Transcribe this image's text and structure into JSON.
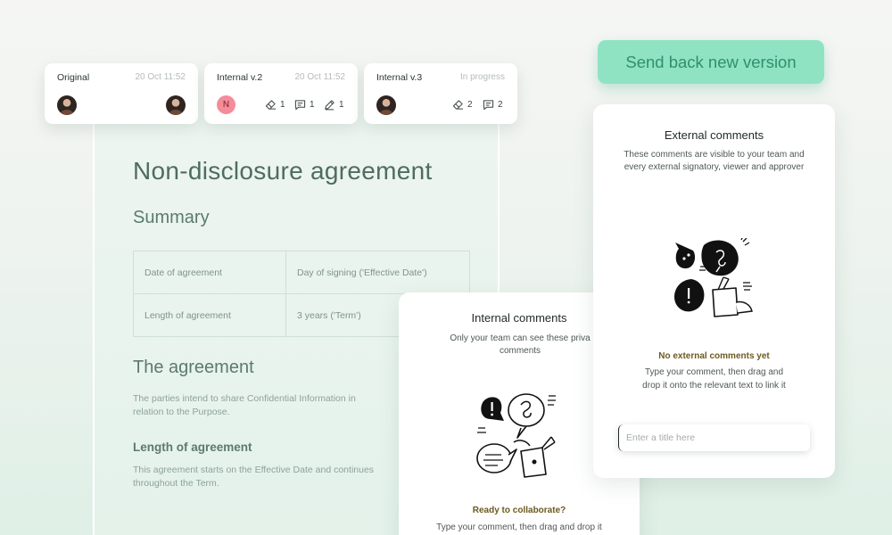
{
  "document": {
    "title": "Non-disclosure agreement",
    "summary_heading": "Summary",
    "table_rows": [
      {
        "label": "Date of agreement",
        "value": "Day of signing ('Effective Date')"
      },
      {
        "label": "Length of agreement",
        "value": "3 years ('Term')"
      }
    ],
    "agreement_heading": "The agreement",
    "agreement_text": "The parties intend to share Confidential Information in relation to the Purpose.",
    "length_heading": "Length of agreement",
    "length_text": "This agreement starts on the Effective Date and continues throughout the Term."
  },
  "versions": [
    {
      "name": "Original",
      "date": "20 Oct 11:52"
    },
    {
      "name": "Internal v.2",
      "date": "20 Oct 11:52",
      "avatar_initial": "N",
      "stats": {
        "edits": "1",
        "comments": "1",
        "signatures": "1"
      }
    },
    {
      "name": "Internal v.3",
      "date": "In progress",
      "stats": {
        "edits": "2",
        "comments": "2"
      }
    }
  ],
  "icons": {
    "edit": "eraser-icon",
    "comment": "comment-icon",
    "signature": "pen-icon"
  },
  "send_button": {
    "label": "Send back new version"
  },
  "internal_comments": {
    "title": "Internal comments",
    "description": "Only your team can see these priva comments",
    "ready_title": "Ready to collaborate?",
    "help_text": "Type your comment, then drag and drop it"
  },
  "external_comments": {
    "title": "External comments",
    "description": "These comments are visible to your team and every external signatory, viewer and approver",
    "empty_title": "No external comments yet",
    "help_text": "Type your comment, then drag and drop it onto the relevant text to link it",
    "input_placeholder": "Enter a title here"
  },
  "colors": {
    "accent": "#8fe3c3",
    "accent_text": "#2f8f6c",
    "heading_green": "#4f6c60",
    "empty_state_text": "#6b5a1f",
    "avatar_n": "#f58c9a"
  }
}
